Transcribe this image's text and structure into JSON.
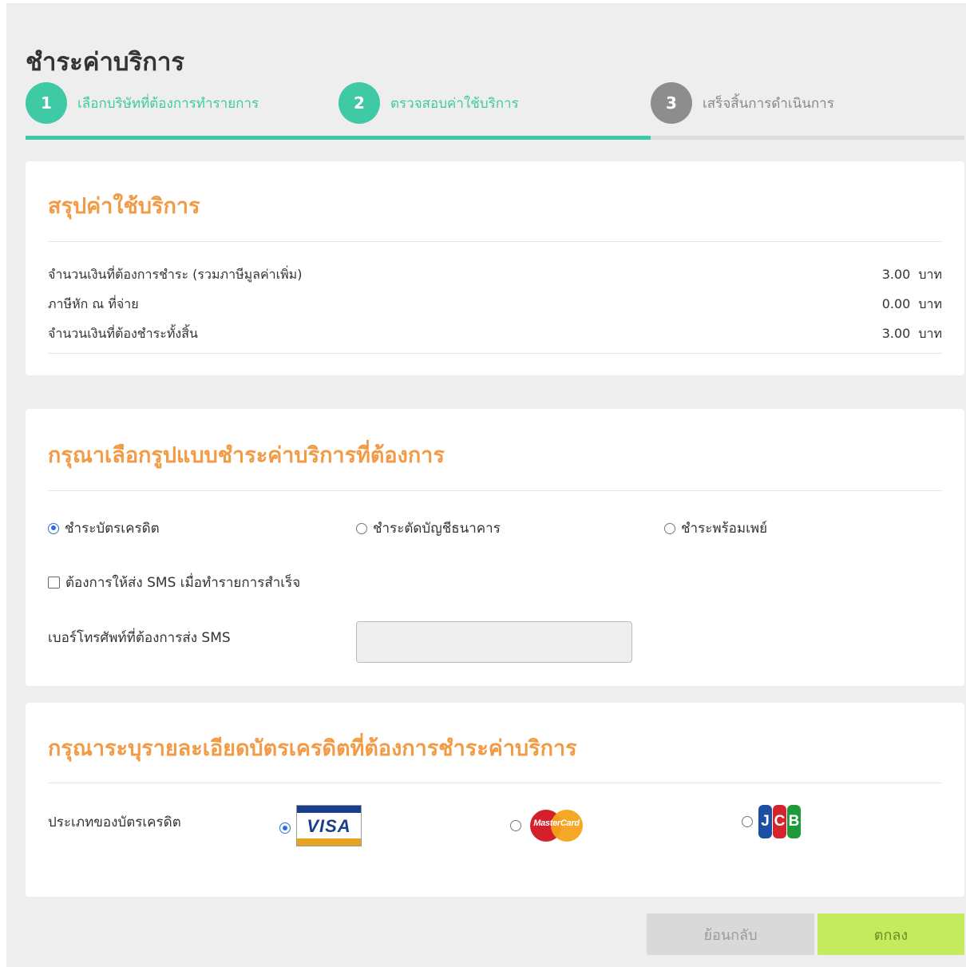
{
  "page": {
    "title": "ชำระค่าบริการ"
  },
  "stepper": {
    "steps": [
      {
        "number": "1",
        "label": "เลือกบริษัทที่ต้องการทำรายการ",
        "state": "active"
      },
      {
        "number": "2",
        "label": "ตรวจสอบค่าใช้บริการ",
        "state": "active"
      },
      {
        "number": "3",
        "label": "เสร็จสิ้นการดำเนินการ",
        "state": "inactive"
      }
    ],
    "colors": {
      "active": "#3fc9a4",
      "inactive": "#8d8d8d"
    }
  },
  "summary": {
    "title": "สรุปค่าใช้บริการ",
    "rows": [
      {
        "label": "จำนวนเงินที่ต้องการชำระ (รวมภาษีมูลค่าเพิ่ม)",
        "amount": "3.00",
        "unit": "บาท"
      },
      {
        "label": "ภาษีหัก ณ ที่จ่าย",
        "amount": "0.00",
        "unit": "บาท"
      },
      {
        "label": "จำนวนเงินที่ต้องชำระทั้งสิ้น",
        "amount": "3.00",
        "unit": "บาท"
      }
    ]
  },
  "payment_method": {
    "title": "กรุณาเลือกรูปแบบชำระค่าบริการที่ต้องการ",
    "options": [
      {
        "label": "ชำระบัตรเครดิต",
        "checked": true
      },
      {
        "label": "ชำระตัดบัญชีธนาคาร",
        "checked": false
      },
      {
        "label": "ชำระพร้อมเพย์",
        "checked": false
      }
    ],
    "sms_checkbox_label": "ต้องการให้ส่ง SMS เมื่อทำรายการสำเร็จ",
    "sms_checked": false,
    "phone_label": "เบอร์โทรศัพท์ที่ต้องการส่ง SMS",
    "phone_value": ""
  },
  "card_details": {
    "title": "กรุณาระบุรายละเอียดบัตรเครดิตที่ต้องการชำระค่าบริการ",
    "card_type_label": "ประเภทของบัตรเครดิต",
    "card_types": [
      {
        "icon": "visa-logo",
        "text": "VISA",
        "checked": true
      },
      {
        "icon": "mastercard-logo",
        "text": "MasterCard",
        "checked": false
      },
      {
        "icon": "jcb-logo",
        "text": "JCB",
        "checked": false
      }
    ]
  },
  "actions": {
    "back_label": "ย้อนกลับ",
    "ok_label": "ตกลง"
  },
  "colors": {
    "accent_orange": "#f39a44",
    "accent_green": "#3fc9a4",
    "ok_button": "#c4ea5e"
  }
}
